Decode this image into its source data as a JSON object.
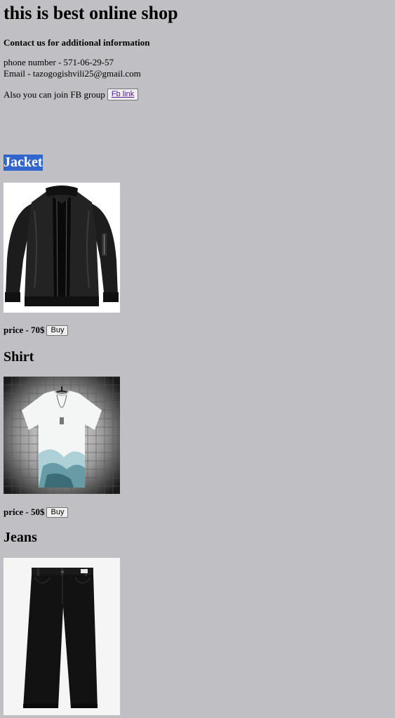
{
  "header": {
    "title": "this is best online shop"
  },
  "contact": {
    "heading": "Contact us for additional information",
    "phone": "phone number - 571-06-29-57",
    "email": "Email - tazogogishvili25@gmail.com",
    "fb_text": "Also you can join FB group",
    "fb_link_label": "Fb link"
  },
  "products": [
    {
      "name": "Jacket",
      "image": "black-bomber-jacket",
      "price_text": "price - 70$",
      "buy_label": "Buy"
    },
    {
      "name": "Shirt",
      "image": "white-printed-tshirt",
      "price_text": "price - 50$",
      "buy_label": "Buy"
    },
    {
      "name": "Jeans",
      "image": "black-jeans"
    }
  ],
  "colors": {
    "background": "#c0bfc4",
    "selection_highlight": "#3366cc",
    "link": "#551a8b"
  }
}
